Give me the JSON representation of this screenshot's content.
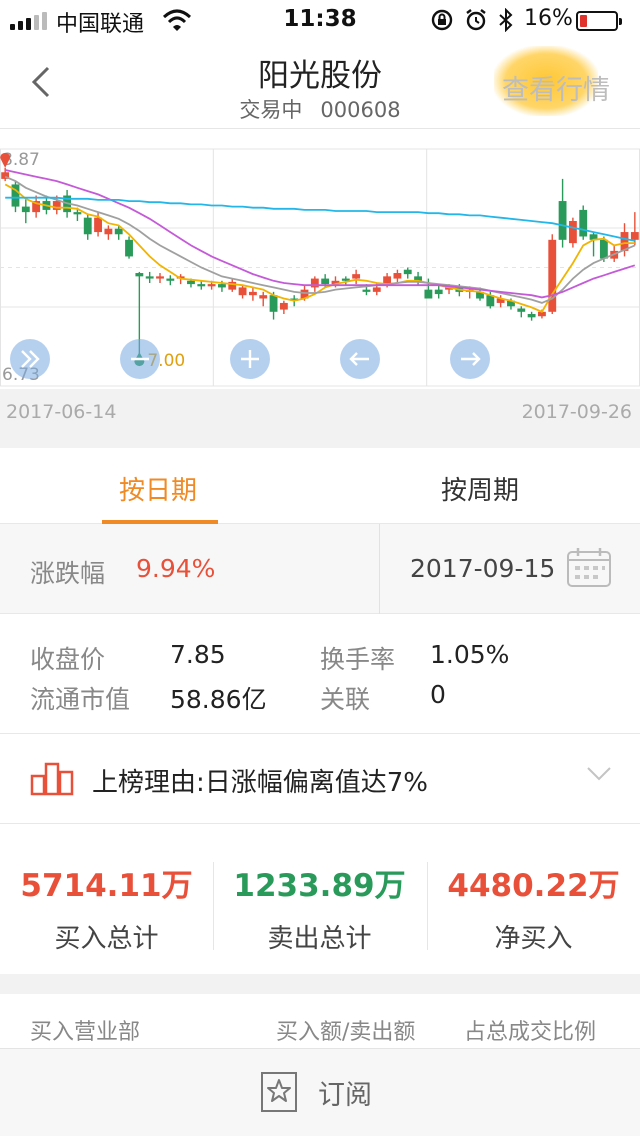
{
  "status_bar": {
    "carrier": "中国联通",
    "time": "11:38",
    "battery": "16%"
  },
  "nav": {
    "title": "阳光股份",
    "status": "交易中",
    "code": "000608",
    "market_button": "查看行情"
  },
  "chart_data": {
    "type": "candlestick",
    "y_max_label": "8.87",
    "y_min_label": "6.73",
    "ylim": [
      6.73,
      8.87
    ],
    "start_date": "2017-06-14",
    "end_date": "2017-09-26",
    "high_marker": "8.60",
    "low_marker": "7.00",
    "up_color": "#e8503a",
    "down_color": "#2a9a5a",
    "candles": [
      [
        8.6,
        8.66,
        8.58,
        8.7
      ],
      [
        8.55,
        8.35,
        8.3,
        8.58
      ],
      [
        8.35,
        8.3,
        8.2,
        8.42
      ],
      [
        8.3,
        8.4,
        8.25,
        8.45
      ],
      [
        8.4,
        8.32,
        8.28,
        8.45
      ],
      [
        8.32,
        8.4,
        8.28,
        8.45
      ],
      [
        8.45,
        8.3,
        8.25,
        8.5
      ],
      [
        8.3,
        8.28,
        8.22,
        8.34
      ],
      [
        8.25,
        8.1,
        8.05,
        8.28
      ],
      [
        8.12,
        8.25,
        8.08,
        8.3
      ],
      [
        8.1,
        8.15,
        8.05,
        8.18
      ],
      [
        8.15,
        8.1,
        8.05,
        8.18
      ],
      [
        8.05,
        7.9,
        7.88,
        8.08
      ],
      [
        7.75,
        7.72,
        7.0,
        7.76
      ],
      [
        7.72,
        7.7,
        7.66,
        7.76
      ],
      [
        7.7,
        7.72,
        7.66,
        7.75
      ],
      [
        7.7,
        7.68,
        7.64,
        7.73
      ],
      [
        7.7,
        7.72,
        7.65,
        7.74
      ],
      [
        7.68,
        7.65,
        7.62,
        7.7
      ],
      [
        7.65,
        7.63,
        7.6,
        7.68
      ],
      [
        7.63,
        7.65,
        7.6,
        7.68
      ],
      [
        7.65,
        7.62,
        7.58,
        7.68
      ],
      [
        7.6,
        7.67,
        7.58,
        7.7
      ],
      [
        7.55,
        7.62,
        7.52,
        7.64
      ],
      [
        7.55,
        7.58,
        7.5,
        7.62
      ],
      [
        7.52,
        7.55,
        7.45,
        7.58
      ],
      [
        7.55,
        7.4,
        7.33,
        7.58
      ],
      [
        7.42,
        7.48,
        7.38,
        7.5
      ],
      [
        7.52,
        7.5,
        7.45,
        7.55
      ],
      [
        7.52,
        7.6,
        7.5,
        7.64
      ],
      [
        7.62,
        7.7,
        7.58,
        7.72
      ],
      [
        7.7,
        7.65,
        7.62,
        7.74
      ],
      [
        7.65,
        7.68,
        7.62,
        7.72
      ],
      [
        7.7,
        7.68,
        7.64,
        7.72
      ],
      [
        7.7,
        7.74,
        7.65,
        7.78
      ],
      [
        7.6,
        7.58,
        7.55,
        7.65
      ],
      [
        7.58,
        7.62,
        7.55,
        7.66
      ],
      [
        7.66,
        7.72,
        7.62,
        7.75
      ],
      [
        7.7,
        7.75,
        7.66,
        7.78
      ],
      [
        7.78,
        7.74,
        7.7,
        7.8
      ],
      [
        7.72,
        7.68,
        7.64,
        7.76
      ],
      [
        7.6,
        7.52,
        7.52,
        7.7
      ],
      [
        7.6,
        7.56,
        7.52,
        7.64
      ],
      [
        7.6,
        7.62,
        7.56,
        7.65
      ],
      [
        7.62,
        7.58,
        7.54,
        7.65
      ],
      [
        7.58,
        7.6,
        7.52,
        7.63
      ],
      [
        7.58,
        7.52,
        7.5,
        7.62
      ],
      [
        7.55,
        7.45,
        7.43,
        7.58
      ],
      [
        7.48,
        7.52,
        7.44,
        7.55
      ],
      [
        7.5,
        7.45,
        7.42,
        7.52
      ],
      [
        7.43,
        7.4,
        7.35,
        7.45
      ],
      [
        7.38,
        7.35,
        7.32,
        7.4
      ],
      [
        7.36,
        7.4,
        7.34,
        7.42
      ],
      [
        7.4,
        8.05,
        7.38,
        8.1
      ],
      [
        8.4,
        8.05,
        7.98,
        8.6
      ],
      [
        8.02,
        8.22,
        7.98,
        8.25
      ],
      [
        8.32,
        8.08,
        8.05,
        8.36
      ],
      [
        8.1,
        8.05,
        7.9,
        8.12
      ],
      [
        8.05,
        7.88,
        7.85,
        8.08
      ],
      [
        7.88,
        7.95,
        7.85,
        8.0
      ],
      [
        7.95,
        8.12,
        7.9,
        8.2
      ],
      [
        8.05,
        8.12,
        8.0,
        8.3
      ]
    ],
    "ma": [
      {
        "name": "ma5",
        "color": "#f1b400",
        "values": [
          8.55,
          8.5,
          8.42,
          8.38,
          8.36,
          8.34,
          8.34,
          8.33,
          8.28,
          8.26,
          8.2,
          8.18,
          8.1,
          8.0,
          7.9,
          7.82,
          7.76,
          7.7,
          7.69,
          7.68,
          7.67,
          7.66,
          7.65,
          7.64,
          7.62,
          7.6,
          7.55,
          7.52,
          7.5,
          7.52,
          7.56,
          7.62,
          7.65,
          7.67,
          7.69,
          7.68,
          7.66,
          7.65,
          7.66,
          7.68,
          7.68,
          7.66,
          7.64,
          7.62,
          7.6,
          7.59,
          7.58,
          7.55,
          7.52,
          7.5,
          7.47,
          7.44,
          7.4,
          7.56,
          7.7,
          7.84,
          8.0,
          8.05,
          8.06,
          8.0,
          8.02,
          8.02
        ]
      },
      {
        "name": "ma10",
        "color": "#a0a0a0",
        "values": [
          8.62,
          8.58,
          8.52,
          8.48,
          8.44,
          8.41,
          8.38,
          8.36,
          8.33,
          8.3,
          8.27,
          8.24,
          8.19,
          8.13,
          8.06,
          8.0,
          7.95,
          7.9,
          7.85,
          7.8,
          7.76,
          7.72,
          7.7,
          7.68,
          7.66,
          7.64,
          7.62,
          7.6,
          7.58,
          7.57,
          7.57,
          7.58,
          7.6,
          7.61,
          7.62,
          7.63,
          7.64,
          7.65,
          7.66,
          7.67,
          7.67,
          7.66,
          7.65,
          7.64,
          7.63,
          7.62,
          7.61,
          7.59,
          7.57,
          7.55,
          7.53,
          7.51,
          7.48,
          7.52,
          7.6,
          7.7,
          7.78,
          7.84,
          7.88,
          7.92,
          7.96,
          8.0
        ]
      },
      {
        "name": "ma20",
        "color": "#c45ad8",
        "values": [
          8.68,
          8.66,
          8.64,
          8.62,
          8.6,
          8.58,
          8.55,
          8.52,
          8.49,
          8.46,
          8.42,
          8.38,
          8.34,
          8.29,
          8.24,
          8.18,
          8.12,
          8.06,
          8.0,
          7.95,
          7.9,
          7.86,
          7.82,
          7.78,
          7.74,
          7.71,
          7.68,
          7.66,
          7.65,
          7.64,
          7.64,
          7.64,
          7.64,
          7.64,
          7.64,
          7.64,
          7.64,
          7.64,
          7.64,
          7.64,
          7.64,
          7.64,
          7.64,
          7.63,
          7.62,
          7.61,
          7.6,
          7.59,
          7.58,
          7.57,
          7.56,
          7.55,
          7.53,
          7.55,
          7.58,
          7.62,
          7.66,
          7.7,
          7.73,
          7.76,
          7.79,
          7.82
        ]
      },
      {
        "name": "ma60",
        "color": "#22b7e8",
        "values": [
          8.43,
          8.43,
          8.43,
          8.43,
          8.43,
          8.43,
          8.42,
          8.42,
          8.42,
          8.41,
          8.41,
          8.41,
          8.4,
          8.4,
          8.39,
          8.39,
          8.38,
          8.38,
          8.37,
          8.37,
          8.36,
          8.36,
          8.35,
          8.35,
          8.34,
          8.34,
          8.33,
          8.33,
          8.33,
          8.32,
          8.32,
          8.32,
          8.31,
          8.31,
          8.31,
          8.31,
          8.3,
          8.3,
          8.3,
          8.3,
          8.3,
          8.29,
          8.29,
          8.28,
          8.28,
          8.27,
          8.27,
          8.26,
          8.25,
          8.24,
          8.23,
          8.22,
          8.21,
          8.2,
          8.18,
          8.16,
          8.14,
          8.12,
          8.1,
          8.08,
          8.06,
          8.04
        ]
      }
    ],
    "controls": [
      "fast-forward",
      "zoom-out",
      "zoom-in",
      "prev",
      "next"
    ]
  },
  "tabs": {
    "by_date": "按日期",
    "by_week": "按周期"
  },
  "change": {
    "label": "涨跌幅",
    "value": "9.94%",
    "date": "2017-09-15"
  },
  "info": {
    "close_label": "收盘价",
    "close_value": "7.85",
    "turnover_label": "换手率",
    "turnover_value": "1.05%",
    "mktcap_label": "流通市值",
    "mktcap_value": "58.86亿",
    "related_label": "关联",
    "related_value": "0"
  },
  "reason": {
    "text": "上榜理由:日涨幅偏离值达7%"
  },
  "totals": {
    "buy_value": "5714.11万",
    "buy_label": "买入总计",
    "sell_value": "1233.89万",
    "sell_label": "卖出总计",
    "net_value": "4480.22万",
    "net_label": "净买入",
    "buy_color": "#e8503a",
    "sell_color": "#2a9a5a"
  },
  "table_header": {
    "col1": "买入营业部",
    "col2": "买入额/卖出额",
    "col3": "占总成交比例"
  },
  "bottom": {
    "subscribe": "订阅"
  }
}
